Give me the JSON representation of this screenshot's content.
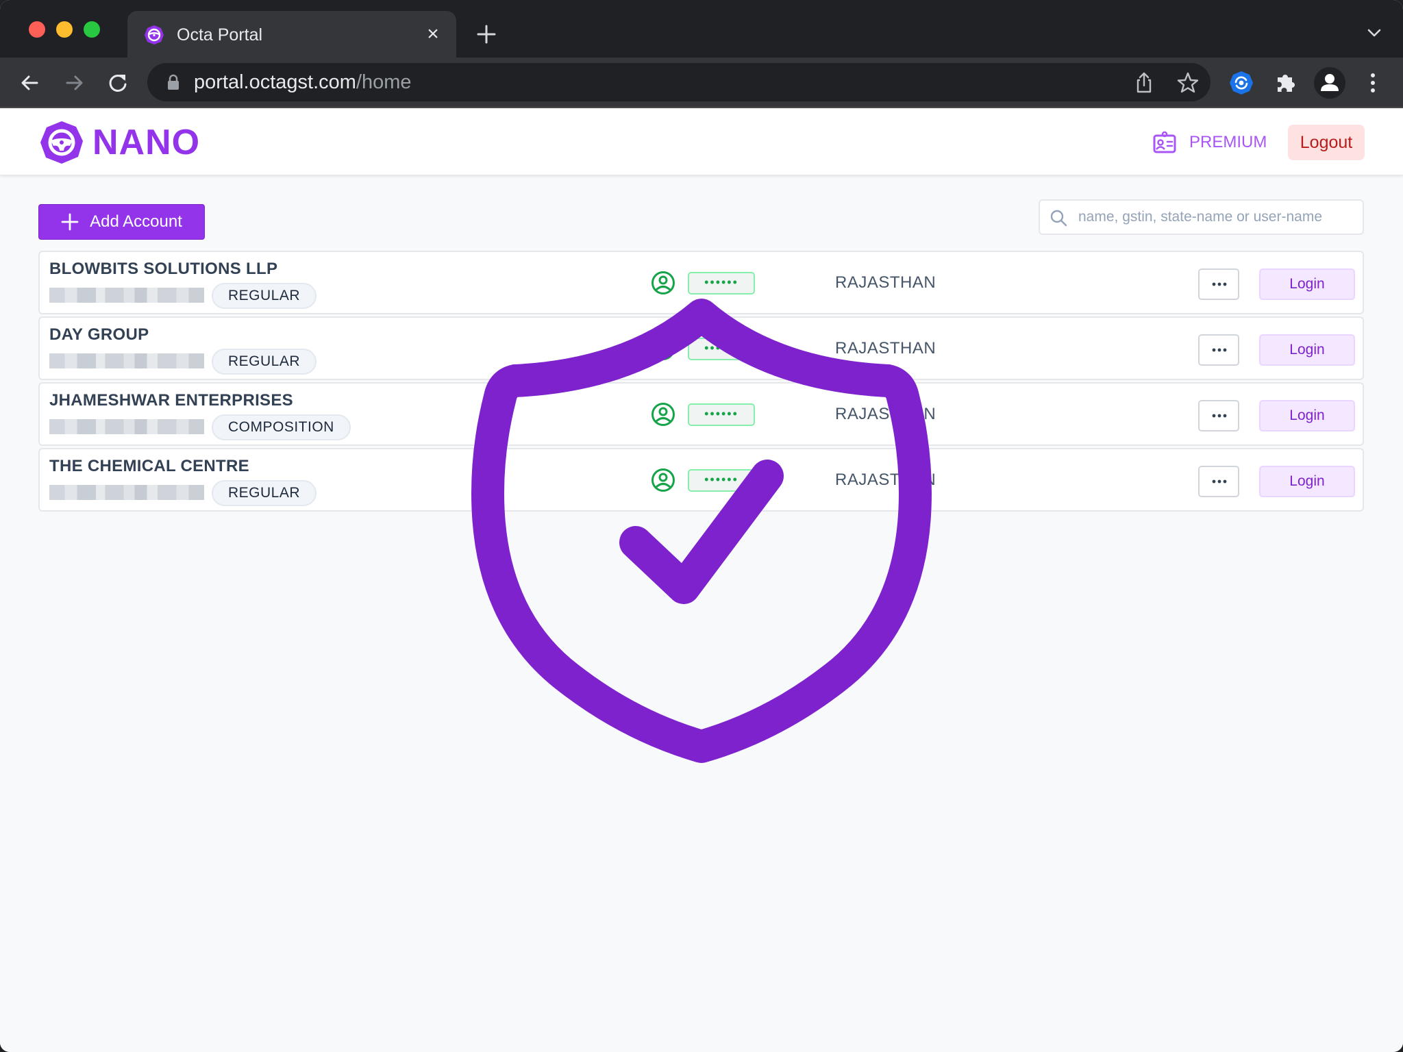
{
  "browser": {
    "tab_title": "Octa Portal",
    "url_host": "portal.octagst.com",
    "url_path": "/home",
    "tab_close_label": "×"
  },
  "header": {
    "logo_text": "NANO",
    "premium_label": "PREMIUM",
    "logout_label": "Logout"
  },
  "toolbar": {
    "add_account_label": "Add Account",
    "search_placeholder": "name, gstin, state-name or user-name",
    "search_value": ""
  },
  "accounts": [
    {
      "name": "BLOWBITS SOLUTIONS LLP",
      "type": "REGULAR",
      "password_mask": "••••••",
      "state": "RAJASTHAN",
      "login_label": "Login"
    },
    {
      "name": "DAY GROUP",
      "type": "REGULAR",
      "password_mask": "••••••",
      "state": "RAJASTHAN",
      "login_label": "Login"
    },
    {
      "name": "JHAMESHWAR ENTERPRISES",
      "type": "COMPOSITION",
      "password_mask": "••••••",
      "state": "RAJASTHAN",
      "login_label": "Login"
    },
    {
      "name": "THE CHEMICAL CENTRE",
      "type": "REGULAR",
      "password_mask": "••••••",
      "state": "RAJASTHAN",
      "login_label": "Login"
    }
  ],
  "colors": {
    "brand": "#9333ea",
    "shield": "#7e22ce",
    "success": "#16a34a",
    "logout_bg": "#fee2e2",
    "logout_text": "#b91c1c"
  },
  "icons": {
    "overlay": "shield-check-icon",
    "credential": "user-circle-icon",
    "more": "ellipsis-icon"
  }
}
